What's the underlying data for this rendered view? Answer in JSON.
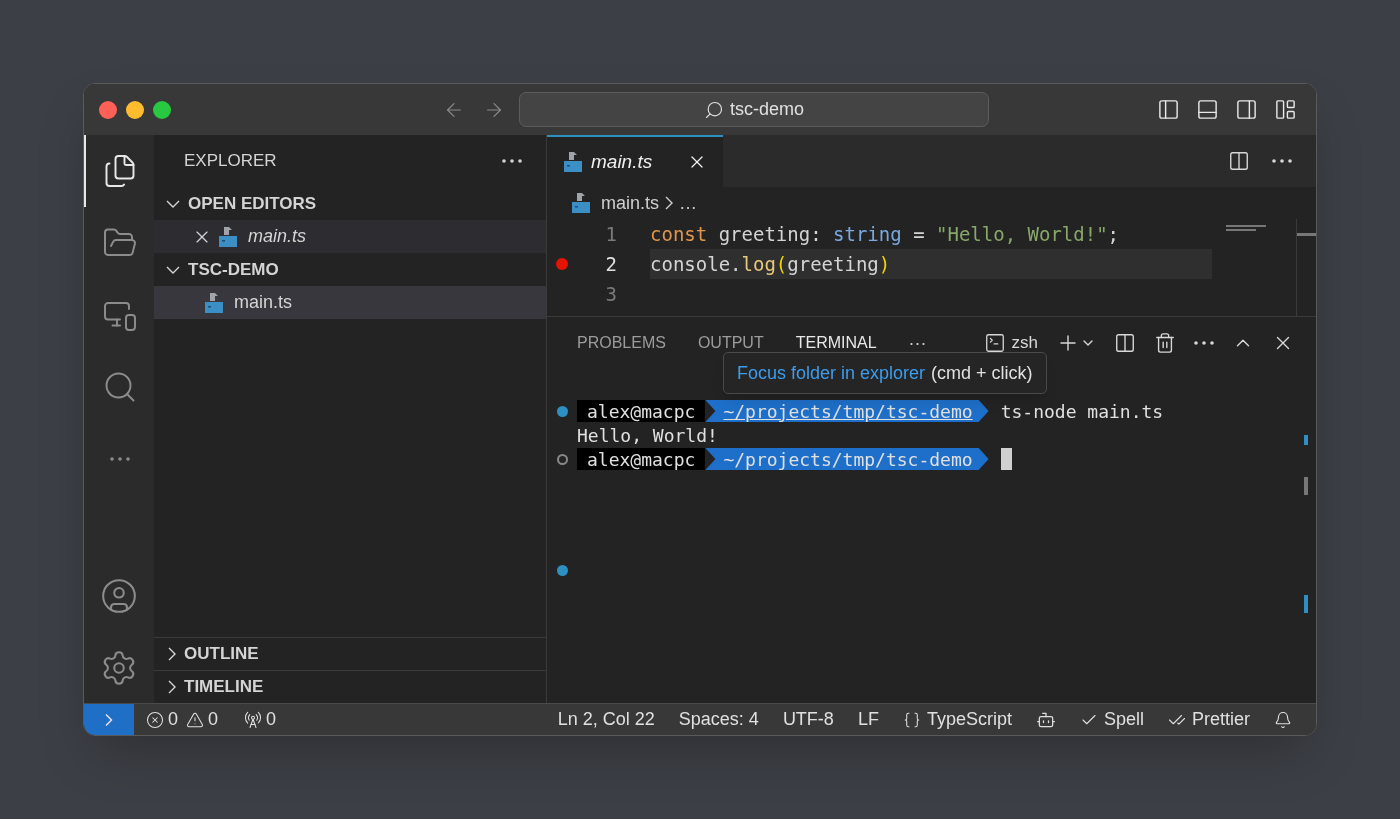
{
  "window": {
    "title": "tsc-demo"
  },
  "activity_bar": [
    {
      "kind": "files",
      "selected": true
    },
    {
      "kind": "folder",
      "selected": false
    },
    {
      "kind": "remote",
      "selected": false
    },
    {
      "kind": "search",
      "selected": false
    },
    {
      "kind": "more",
      "selected": false
    }
  ],
  "activity_bottom": [
    {
      "kind": "account"
    },
    {
      "kind": "settings"
    }
  ],
  "sidebar": {
    "title": "EXPLORER",
    "sections": [
      {
        "title": "OPEN EDITORS",
        "expanded": true,
        "items": [
          {
            "name": "main.ts",
            "kind": "open-editor",
            "preview": true,
            "selected": false
          }
        ]
      },
      {
        "title": "TSC-DEMO",
        "expanded": true,
        "items": [
          {
            "name": "main.ts",
            "kind": "file",
            "preview": false,
            "selected": true
          }
        ]
      },
      {
        "title": "OUTLINE",
        "expanded": false
      },
      {
        "title": "TIMELINE",
        "expanded": false
      }
    ]
  },
  "editor": {
    "tabs": [
      {
        "label": "main.ts",
        "selected": true,
        "preview": true
      }
    ],
    "breadcrumb": [
      "main.ts",
      "…"
    ],
    "lines": [
      {
        "number": "1",
        "breakpoint": false,
        "current": false,
        "tokens": [
          {
            "text": "const",
            "kind": "keyword"
          },
          {
            "text": " greeting: ",
            "kind": "plain"
          },
          {
            "text": "string",
            "kind": "type"
          },
          {
            "text": " = ",
            "kind": "plain"
          },
          {
            "text": "\"Hello, World!\"",
            "kind": "string"
          },
          {
            "text": ";",
            "kind": "plain"
          }
        ]
      },
      {
        "number": "2",
        "breakpoint": true,
        "current": true,
        "tokens": [
          {
            "text": "console.",
            "kind": "plain"
          },
          {
            "text": "log",
            "kind": "function"
          },
          {
            "text": "(",
            "kind": "bracket"
          },
          {
            "text": "greeting",
            "kind": "plain"
          },
          {
            "text": ")",
            "kind": "bracket"
          }
        ]
      },
      {
        "number": "3",
        "breakpoint": false,
        "current": false
      }
    ]
  },
  "panel": {
    "tabs": [
      {
        "label": "PROBLEMS",
        "selected": false
      },
      {
        "label": "OUTPUT",
        "selected": false
      },
      {
        "label": "TERMINAL",
        "selected": true
      }
    ],
    "more": "···",
    "terminal_name": "zsh",
    "tooltip": {
      "link": "Focus folder in explorer",
      "hint": "(cmd + click)"
    },
    "terminal": [
      {
        "kind": "prompt",
        "succeeded": true,
        "user": "alex@macpc",
        "path": "~/projects/tmp/tsc-demo",
        "underlined": true,
        "command": "ts-node main.ts"
      },
      {
        "kind": "output",
        "text": "Hello, World!"
      },
      {
        "kind": "prompt",
        "succeeded": false,
        "user": "alex@macpc",
        "path": "~/projects/tmp/tsc-demo",
        "underlined": false,
        "cursor": true
      }
    ]
  },
  "status_bar": {
    "errors": "0",
    "warnings": "0",
    "ports": "0",
    "position": "Ln 2, Col 22",
    "spaces": "Spaces: 4",
    "encoding": "UTF-8",
    "eol": "LF",
    "language": "TypeScript",
    "spell": "Spell",
    "prettier": "Prettier"
  }
}
